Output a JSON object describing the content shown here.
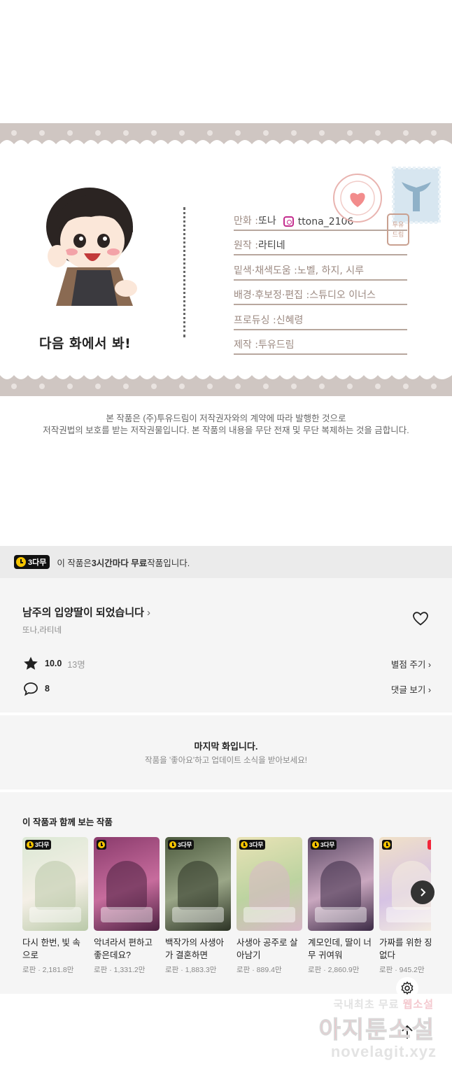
{
  "credits": {
    "next_episode": "다음 화에서 봐!",
    "rows": [
      {
        "label": "만화 : ",
        "value": "또나",
        "insta": "ttona_2106"
      },
      {
        "label": "원작 : ",
        "value": "라티네"
      },
      {
        "label": "밑색·채색도움 : ",
        "value": "노벨, 하지, 시루"
      },
      {
        "label": "배경·후보정·편집 : ",
        "value": "스튜디오 이너스"
      },
      {
        "label": "프로듀싱 : ",
        "value": "신혜령"
      },
      {
        "label": "제작 : ",
        "value": "투유드림"
      }
    ],
    "seal_text": "투유 드림"
  },
  "copyright": {
    "line1": "본 작품은 (주)투유드림이 저작권자와의 계약에 따라 발행한 것으로",
    "line2": "저작권법의 보호를 받는 저작권물입니다. 본 작품의 내용을 무단 전재 및 무단 복제하는 것을 금합니다."
  },
  "free_banner": {
    "badge": "3다무",
    "text_pre": "이 작품은 ",
    "text_bold": "3시간마다 무료",
    "text_post": " 작품입니다."
  },
  "series": {
    "title": "남주의 입양딸이 되었습니다",
    "chevron": "›",
    "authors": "또나,라티네",
    "rating": "10.0",
    "rating_count": "13명",
    "rate_link": "별점 주기 ›",
    "comments": "8",
    "comments_link": "댓글 보기 ›"
  },
  "last_episode": {
    "title": "마지막 화입니다.",
    "subtitle": "작품을 '좋아요'하고 업데이트 소식을 받아보세요!"
  },
  "recommendations": {
    "heading": "이 작품과 함께 보는 작품",
    "items": [
      {
        "title": "다시 한번, 빛 속으로",
        "genre": "로판",
        "views": "2,181.8만",
        "badge": "3다무",
        "up": "",
        "colors": [
          "#dbe8d4",
          "#f4efe6",
          "#b9c9a8"
        ]
      },
      {
        "title": "악녀라서 편하고 좋은데요?",
        "genre": "로판",
        "views": "1,331.2만",
        "badge": "",
        "up": "",
        "colors": [
          "#8a3b6c",
          "#c76c9d",
          "#4b2040"
        ]
      },
      {
        "title": "백작가의 사생아가 결혼하면",
        "genre": "로판",
        "views": "1,883.3만",
        "badge": "3다무",
        "up": "",
        "colors": [
          "#4c5a3e",
          "#9aa687",
          "#2c3325"
        ]
      },
      {
        "title": "사생아 공주로 살아남기",
        "genre": "로판",
        "views": "889.4만",
        "badge": "3다무",
        "up": "",
        "colors": [
          "#e9e3b6",
          "#bcd3a0",
          "#d8b8c8"
        ]
      },
      {
        "title": "계모인데, 딸이 너무 귀여워",
        "genre": "로판",
        "views": "2,860.9만",
        "badge": "3다무",
        "up": "",
        "colors": [
          "#5d4a66",
          "#c9a7bf",
          "#3b2a45"
        ]
      },
      {
        "title": "가짜를 위한 장는 없다",
        "genre": "로판",
        "views": "945.2만",
        "badge": "",
        "up": "UP",
        "colors": [
          "#f1e1c7",
          "#d6c3e4",
          "#f6efe0"
        ]
      }
    ]
  },
  "watermark": {
    "line1_pre": "국내최초 무료 ",
    "line1_hl": "웹소설",
    "line2": "아지툰소설",
    "line3": "novelagit.xyz"
  },
  "icons": {
    "heart": "heart-icon",
    "star": "star-icon",
    "comment": "comment-icon",
    "settings": "gear-icon",
    "scroll_top": "arrow-up-icon",
    "next": "chevron-right-icon"
  }
}
